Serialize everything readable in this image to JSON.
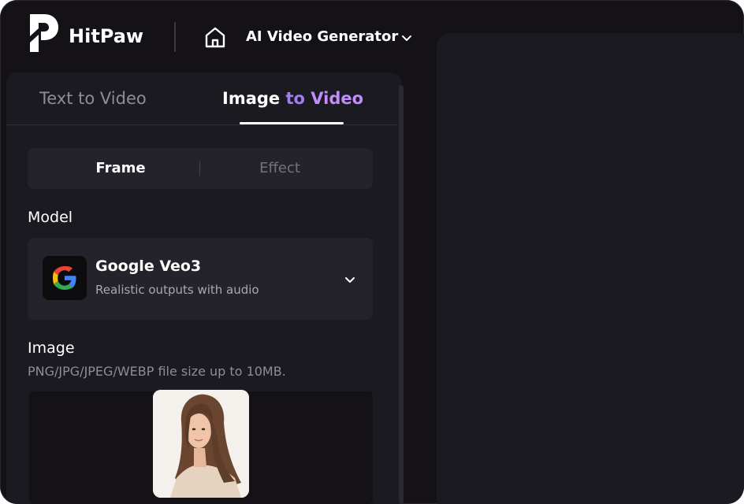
{
  "header": {
    "brand": "HitPaw",
    "nav_title": "AI Video Generator",
    "icons": [
      "hitpaw-logo-icon",
      "home-icon",
      "chevron-down-icon"
    ]
  },
  "tabs": [
    {
      "label": "Text to Video",
      "active": false
    },
    {
      "label_parts": [
        "Image",
        "to",
        "Video"
      ],
      "active": true
    }
  ],
  "segments": [
    {
      "label": "Frame",
      "active": true
    },
    {
      "label": "Effect",
      "active": false
    }
  ],
  "model": {
    "section_label": "Model",
    "name": "Google Veo3",
    "description": "Realistic outputs with audio",
    "icon": "google-logo-icon"
  },
  "image": {
    "section_label": "Image",
    "hint": "PNG/JPG/JPEG/WEBP file size up to 10MB."
  },
  "colors": {
    "background": "#141217",
    "panel": "#1c1a21",
    "card": "#24222a",
    "accent": "#a27cf5",
    "text_primary": "#ffffff",
    "text_muted": "#8e8c95"
  }
}
